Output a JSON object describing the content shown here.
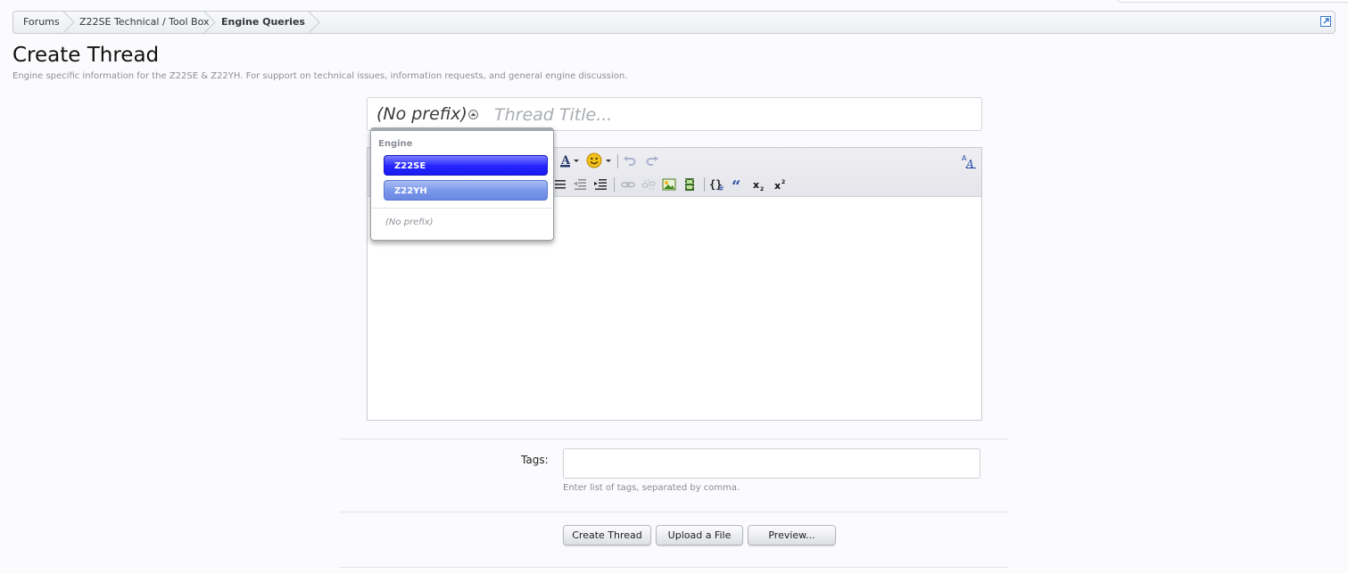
{
  "breadcrumb": {
    "items": [
      "Forums",
      "Z22SE Technical / Tool Box"
    ],
    "current": "Engine Queries"
  },
  "page": {
    "title": "Create Thread",
    "description": "Engine specific information for the Z22SE & Z22YH. For support on technical issues, information requests, and general engine discussion."
  },
  "title_field": {
    "prefix": "(No prefix)",
    "placeholder": "Thread Title..."
  },
  "prefix_menu": {
    "group": "Engine",
    "options": [
      "Z22SE",
      "Z22YH"
    ],
    "none": "(No prefix)"
  },
  "tags": {
    "label": "Tags:",
    "value": "",
    "hint": "Enter list of tags, separated by comma."
  },
  "buttons": {
    "create": "Create Thread",
    "upload": "Upload a File",
    "preview": "Preview..."
  },
  "colors": {
    "selected_option": "#2424ff",
    "hover_option": "#7896ea",
    "toolbar_bg": "#e8e9ee"
  }
}
